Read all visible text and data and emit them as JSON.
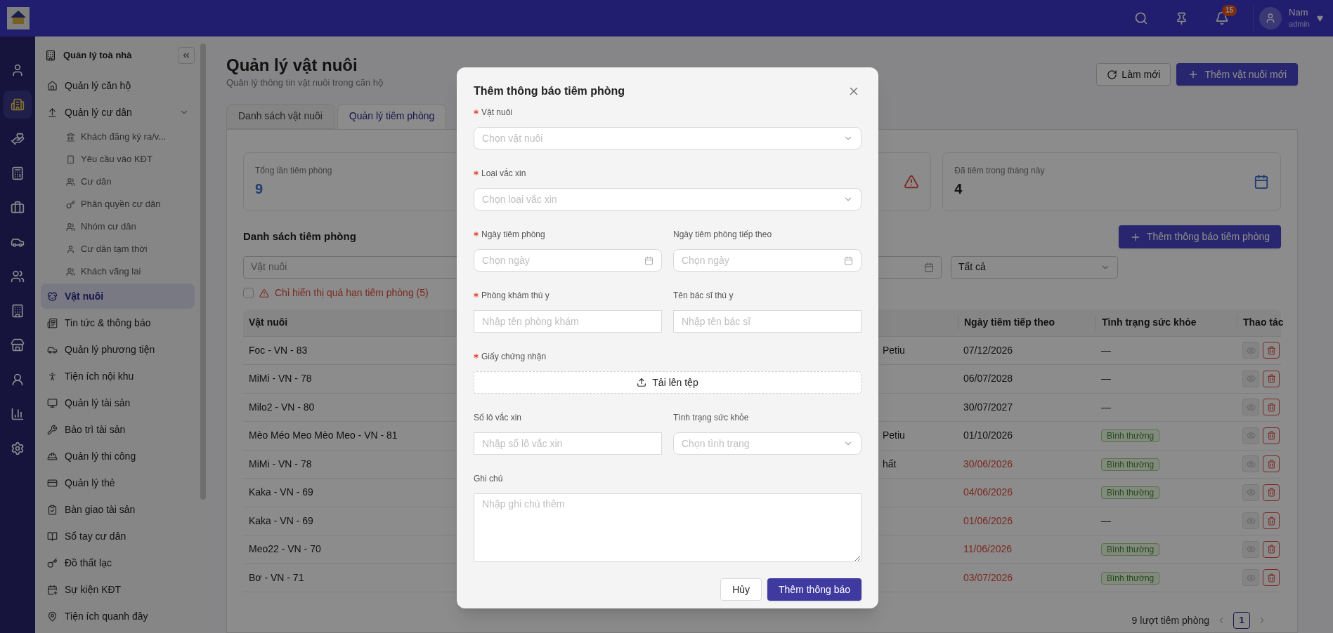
{
  "topbar": {
    "notification_count": "15",
    "user_name": "Nam",
    "user_role": "admin"
  },
  "rail": [
    {
      "selected": false
    },
    {
      "selected": true
    },
    {
      "selected": false
    },
    {
      "selected": false
    },
    {
      "selected": false
    },
    {
      "selected": false
    },
    {
      "selected": false
    },
    {
      "selected": false
    },
    {
      "selected": false
    },
    {
      "selected": false
    },
    {
      "selected": false
    },
    {
      "selected": false
    }
  ],
  "sidebar": {
    "title": "Quản lý toà nhà",
    "items": [
      {
        "label": "Quản lý căn hộ",
        "selected": false
      },
      {
        "label": "Quản lý cư dân",
        "selected": false,
        "expanded": true,
        "children": [
          {
            "label": "Khách đăng ký ra/v...",
            "selected": false
          },
          {
            "label": "Yêu cầu vào KĐT",
            "selected": false
          },
          {
            "label": "Cư dân",
            "selected": false
          },
          {
            "label": "Phân quyền cư dân",
            "selected": false
          },
          {
            "label": "Nhóm cư dân",
            "selected": false
          },
          {
            "label": "Cư dân tạm thời",
            "selected": false
          },
          {
            "label": "Khách vãng lai",
            "selected": false
          }
        ]
      },
      {
        "label": "Vật nuôi",
        "selected": true
      },
      {
        "label": "Tin tức & thông báo",
        "selected": false
      },
      {
        "label": "Quản lý phương tiện",
        "selected": false
      },
      {
        "label": "Tiện ích nội khu",
        "selected": false
      },
      {
        "label": "Quản lý tài sản",
        "selected": false
      },
      {
        "label": "Bảo trì tài sản",
        "selected": false
      },
      {
        "label": "Quản lý thi công",
        "selected": false
      },
      {
        "label": "Quản lý thẻ",
        "selected": false
      },
      {
        "label": "Bàn giao tài sản",
        "selected": false
      },
      {
        "label": "Sổ tay cư dân",
        "selected": false
      },
      {
        "label": "Đồ thất lạc",
        "selected": false
      },
      {
        "label": "Sự kiện KĐT",
        "selected": false
      },
      {
        "label": "Tiện ích quanh đây",
        "selected": false
      }
    ]
  },
  "page": {
    "title": "Quản lý vật nuôi",
    "subtitle": "Quản lý thông tin vật nuôi trong căn hộ",
    "buttons": [
      {
        "kind": "refresh",
        "label": "Làm mới"
      },
      {
        "kind": "add",
        "label": "Thêm vật nuôi mới"
      }
    ]
  },
  "tabs": [
    {
      "label": "Danh sách vật nuôi",
      "selected": false
    },
    {
      "label": "Quản lý tiêm phòng",
      "selected": true
    }
  ],
  "stats": [
    {
      "kind": "plain",
      "label": "Tổng lần tiêm phòng",
      "value": "9"
    },
    {
      "kind": "warning"
    },
    {
      "kind": "calendar",
      "label": "Đã tiêm trong tháng này",
      "value": "4"
    }
  ],
  "list": {
    "title": "Danh sách tiêm phòng",
    "add_button": "Thêm thông báo tiêm phòng",
    "filters": {
      "pet_placeholder": "Vật nuôi",
      "status_value": "Tất cả"
    },
    "overdue_filter": {
      "checked": false,
      "label": "Chỉ hiển thị quá hạn tiêm phòng (5)"
    }
  },
  "table": {
    "columns": [
      "Vật nuôi",
      "Ngày tiêm tiếp theo",
      "Tình trạng sức khỏe",
      "Thao tác"
    ],
    "rows": [
      {
        "pet": "Foc - VN - 83",
        "column_2": "Petiu",
        "next_date": "07/12/2026",
        "overdue": false,
        "health": "—",
        "badge": false
      },
      {
        "pet": "MiMi - VN - 78",
        "next_date": "06/07/2028",
        "overdue": false,
        "health": "—",
        "badge": false
      },
      {
        "pet": "Milo2 - VN - 80",
        "next_date": "30/07/2027",
        "overdue": false,
        "health": "—",
        "badge": false
      },
      {
        "pet": "Mèo Méo Meo Mèo Meo - VN - 81",
        "column_2": "Petiu",
        "next_date": "01/10/2026",
        "overdue": false,
        "health": "Bình thường",
        "badge": true
      },
      {
        "pet": "MiMi - VN - 78",
        "column_2": "hất",
        "next_date": "30/06/2026",
        "overdue": true,
        "health": "Bình thường",
        "badge": true
      },
      {
        "pet": "Kaka - VN - 69",
        "next_date": "04/06/2026",
        "overdue": true,
        "health": "Bình thường",
        "badge": true
      },
      {
        "pet": "Kaka - VN - 69",
        "next_date": "01/06/2026",
        "overdue": true,
        "health": "—",
        "badge": false
      },
      {
        "pet": "Meo22 - VN - 70",
        "next_date": "11/06/2026",
        "overdue": true,
        "health": "Bình thường",
        "badge": true
      },
      {
        "pet": "Bơ - VN - 71",
        "next_date": "03/07/2026",
        "overdue": true,
        "health": "Bình thường",
        "badge": true
      }
    ]
  },
  "pagination": {
    "summary": "9 lượt tiêm phòng",
    "pages": [
      {
        "label": "1",
        "selected": true
      }
    ]
  },
  "modal": {
    "title": "Thêm thông báo tiêm phòng",
    "rows": [
      [
        {
          "kind": "select",
          "label": "Vật nuôi",
          "required": true,
          "placeholder": "Chọn vật nuôi"
        }
      ],
      [
        {
          "kind": "select",
          "label": "Loại vắc xin",
          "required": true,
          "placeholder": "Chọn loại vắc xin"
        }
      ],
      [
        {
          "kind": "date",
          "label": "Ngày tiêm phòng",
          "required": true,
          "placeholder": "Chọn ngày"
        },
        {
          "kind": "date",
          "label": "Ngày tiêm phòng tiếp theo",
          "required": false,
          "placeholder": "Chọn ngày"
        }
      ],
      [
        {
          "kind": "text",
          "label": "Phòng khám thú y",
          "required": true,
          "placeholder": "Nhập tên phòng khám"
        },
        {
          "kind": "text",
          "label": "Tên bác sĩ thú y",
          "required": false,
          "placeholder": "Nhập tên bác sĩ"
        }
      ],
      [
        {
          "kind": "upload",
          "label": "Giấy chứng nhận",
          "required": true,
          "button": "Tải lên tệp"
        }
      ],
      [
        {
          "kind": "text",
          "label": "Số lô vắc xin",
          "required": false,
          "placeholder": "Nhập số lô vắc xin"
        },
        {
          "kind": "select",
          "label": "Tình trạng sức khỏe",
          "required": false,
          "placeholder": "Chọn tình trạng"
        }
      ],
      [
        {
          "kind": "textarea",
          "label": "Ghi chú",
          "required": false,
          "placeholder": "Nhập ghi chú thêm"
        }
      ]
    ],
    "cancel": "Hủy",
    "submit": "Thêm thông báo"
  }
}
